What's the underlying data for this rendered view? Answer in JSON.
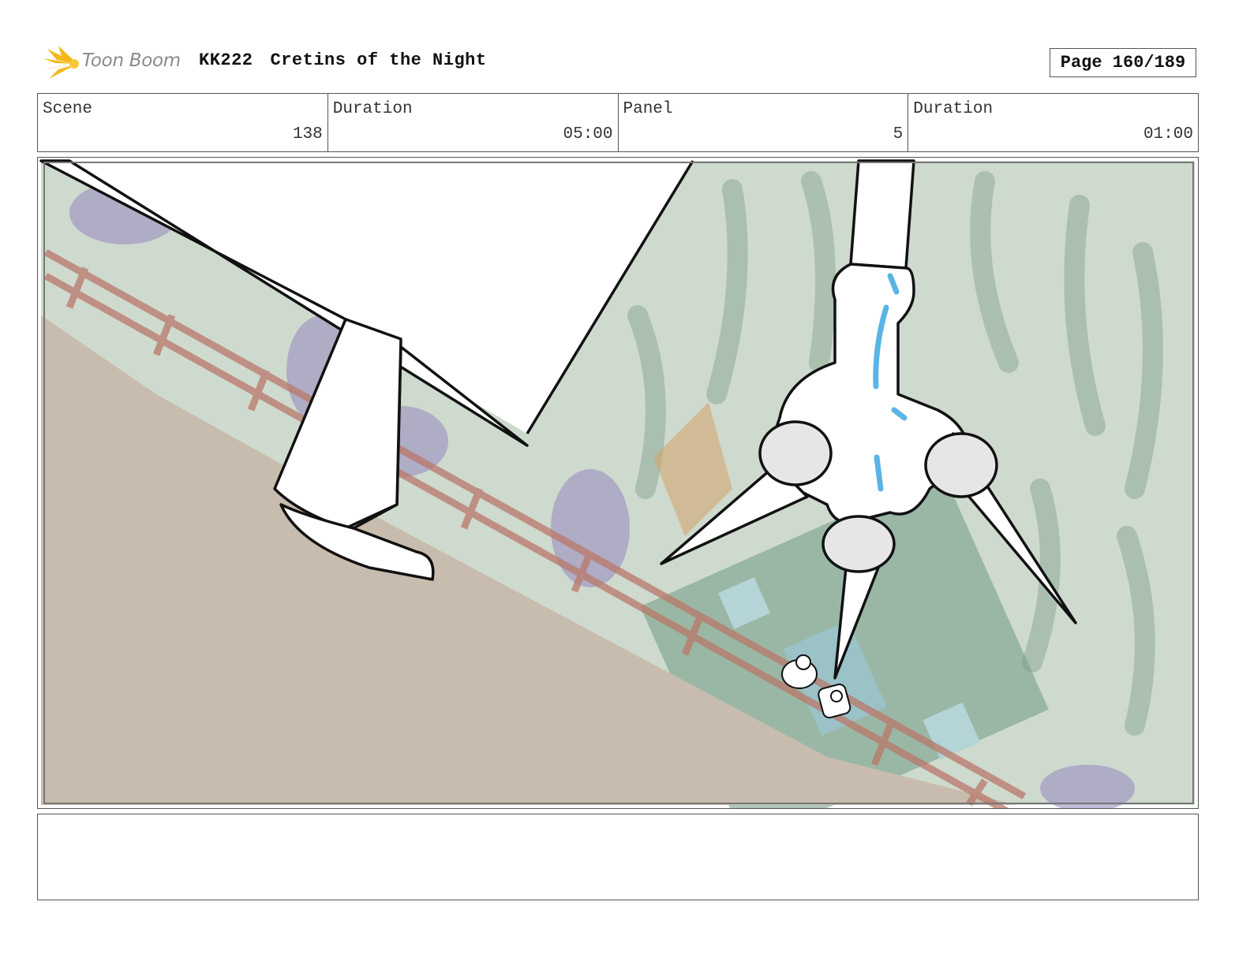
{
  "header": {
    "logo_text": "Toon Boom",
    "production_code": "KK222",
    "episode_title": "Cretins of the Night",
    "page_label": "Page 160/189"
  },
  "info": {
    "scene_label": "Scene",
    "scene_value": "138",
    "scene_duration_label": "Duration",
    "scene_duration_value": "05:00",
    "panel_label": "Panel",
    "panel_value": "5",
    "panel_duration_label": "Duration",
    "panel_duration_value": "01:00"
  },
  "panel": {
    "colors": {
      "ground": "#c8bcae",
      "foliage": "#7fa08a",
      "fence": "#b9786a",
      "purple_plants": "#9a8ec0",
      "highlight": "#5ab4e6"
    }
  },
  "notes": {
    "text": ""
  }
}
